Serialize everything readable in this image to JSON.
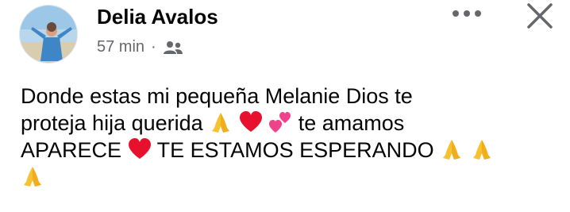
{
  "post": {
    "author": "Delia Avalos",
    "time": "57 min",
    "separator": "·",
    "audience_icon": "friends-icon",
    "lines": [
      {
        "text": "Donde estas mi pequeña Melanie Dios te"
      },
      {
        "text_a": "proteja hija querida",
        "text_b": "te amamos",
        "emojis": [
          "folded-hands",
          "red-heart",
          "two-hearts"
        ]
      },
      {
        "text_a": "APARECE",
        "text_b": "TE ESTAMOS ESPERANDO",
        "emojis": [
          "red-heart",
          "folded-hands",
          "folded-hands"
        ]
      },
      {
        "emojis": [
          "folded-hands"
        ]
      }
    ]
  },
  "header_actions": {
    "more_icon": "more-options-icon",
    "close_icon": "close-icon"
  },
  "colors": {
    "text": "#050505",
    "meta": "#65676b",
    "heart": "#e8112d",
    "hands": "#f7c232"
  }
}
